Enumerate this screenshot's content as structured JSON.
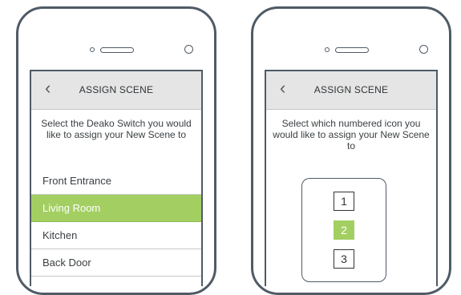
{
  "colors": {
    "frame": "#4f5b66",
    "header_bg": "#e5e5e5",
    "accent_green": "#a3cf62"
  },
  "left_phone": {
    "header": {
      "back_icon": "chevron-left-icon",
      "back_glyph": "‹",
      "title": "ASSIGN SCENE"
    },
    "instructions": "Select the Deako Switch you would like to assign your New Scene to",
    "switches": [
      {
        "label": "Front Entrance",
        "selected": false
      },
      {
        "label": "Living Room",
        "selected": true
      },
      {
        "label": "Kitchen",
        "selected": false
      },
      {
        "label": "Back Door",
        "selected": false
      }
    ]
  },
  "right_phone": {
    "header": {
      "back_icon": "chevron-left-icon",
      "back_glyph": "‹",
      "title": "ASSIGN SCENE"
    },
    "instructions": "Select which numbered icon you would like to assign your New Scene to",
    "icons": [
      {
        "label": "1",
        "selected": false
      },
      {
        "label": "2",
        "selected": true
      },
      {
        "label": "3",
        "selected": false
      }
    ]
  }
}
